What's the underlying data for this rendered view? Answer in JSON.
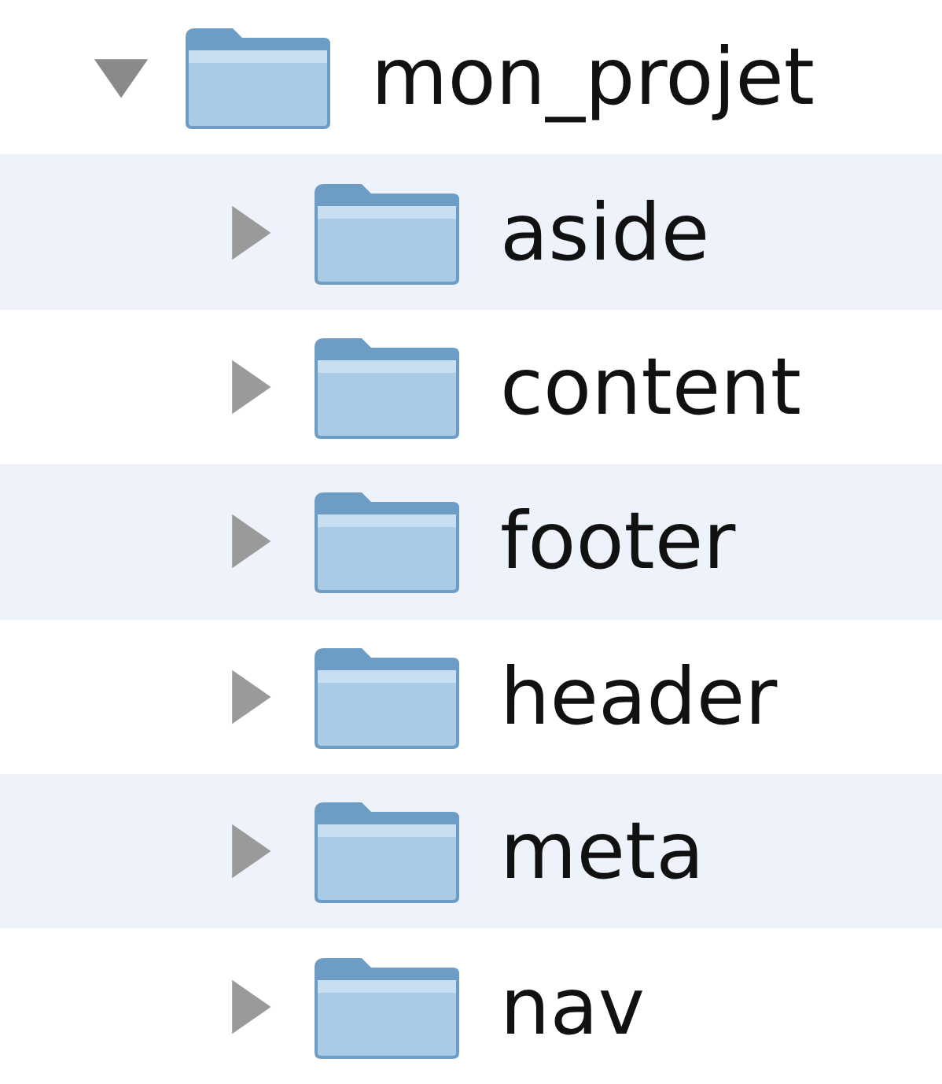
{
  "tree": [
    {
      "name": "mon_projet",
      "expanded": true,
      "children": [
        {
          "name": "aside",
          "expanded": false
        },
        {
          "name": "content",
          "expanded": false
        },
        {
          "name": "footer",
          "expanded": false
        },
        {
          "name": "header",
          "expanded": false
        },
        {
          "name": "meta",
          "expanded": false
        },
        {
          "name": "nav",
          "expanded": false
        }
      ]
    }
  ]
}
